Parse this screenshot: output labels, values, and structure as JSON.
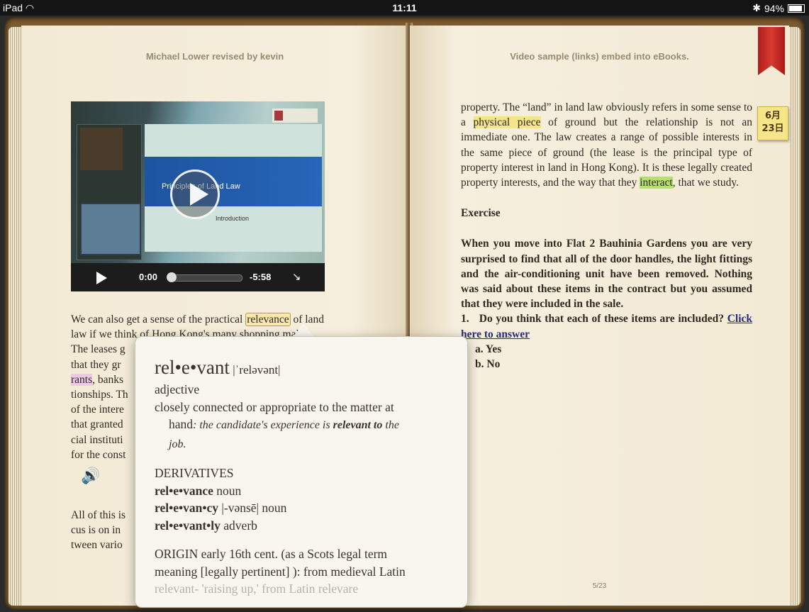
{
  "status_bar": {
    "device": "iPad",
    "time": "11:11",
    "battery": "94%"
  },
  "left_page": {
    "running_head": "Michael Lower revised by kevin",
    "video": {
      "slide_title": "Principles of Land Law",
      "slide_subtitle": "Introduction",
      "elapsed": "0:00",
      "remaining": "-5:58",
      "progress": 0
    },
    "para1": {
      "l1a": "We can also get a sense of the practical ",
      "l1_selected": "relevance",
      "l1b": " of land",
      "l2": "law if we think of Hong Kong's many shopping malls.",
      "l3": "The leases g",
      "l4": "that they gr",
      "l5_hl": "rants",
      "l5b": ", banks",
      "l6": "tionships. Th",
      "l7": "of the intere",
      "l8": "that granted",
      "l9": "cial instituti",
      "l10": "for the const"
    },
    "para2": {
      "l1": "All of this is",
      "l2": "cus is on in",
      "l3": "tween vario"
    }
  },
  "right_page": {
    "running_head": "Video sample (links) embed into eBooks.",
    "para1": {
      "p1": "property. The “land” in land law obviously refers in some sense to a ",
      "hl1": "physical piece",
      "p2": " of ground but the relationship is not an immediate one. The law creates a range of possible interests in the same piece of ground (the lease is the principal type of property interest in land in Hong Kong). It is these legally created property interests, and the way that they ",
      "hl2": "interact",
      "p3": ", that we study."
    },
    "exercise_heading": "Exercise",
    "exercise_text": "When you move into Flat 2 Bauhinia Gardens you are very surprised to find that all of the door handles, the light fittings and the air-conditioning unit have been removed. Nothing was said about these items in the contract but you assumed that they were included in the sale.",
    "question_num": "1.",
    "question_text": "Do you think that each of these items are included?",
    "question_link": "Click here to answer",
    "options": [
      "a. Yes",
      "b. No"
    ],
    "page_number": "5/23"
  },
  "sticky_note": {
    "line1": "6月",
    "line2": "23日"
  },
  "dictionary": {
    "headword": "rel•e•vant",
    "pronunciation": "|ˈreləvənt|",
    "part_of_speech": "adjective",
    "definition": "closely connected or appropriate to the matter at",
    "definition_cont": "hand",
    "example_a": ": the candidate's experience is ",
    "example_b": "relevant to",
    "example_c": " the",
    "example_end": "job.",
    "derivatives_heading": "DERIVATIVES",
    "derivatives": [
      {
        "word": "rel•e•vance",
        "pron": "",
        "pos": "noun"
      },
      {
        "word": "rel•e•van•cy",
        "pron": "|-vənsē|",
        "pos": "noun"
      },
      {
        "word": "rel•e•vant•ly",
        "pron": "",
        "pos": "adverb"
      }
    ],
    "origin_1": "ORIGIN early 16th cent. (as a Scots legal term",
    "origin_2": "meaning [legally pertinent] ): from medieval Latin",
    "origin_3": "relevant- 'raising up,' from Latin relevare"
  },
  "colors": {
    "highlight_yellow": "#f4e58a",
    "highlight_green": "#b6e06d",
    "highlight_pink": "#eec9e6",
    "bookmark_red": "#d83a2e",
    "link": "#2b2a7d"
  }
}
